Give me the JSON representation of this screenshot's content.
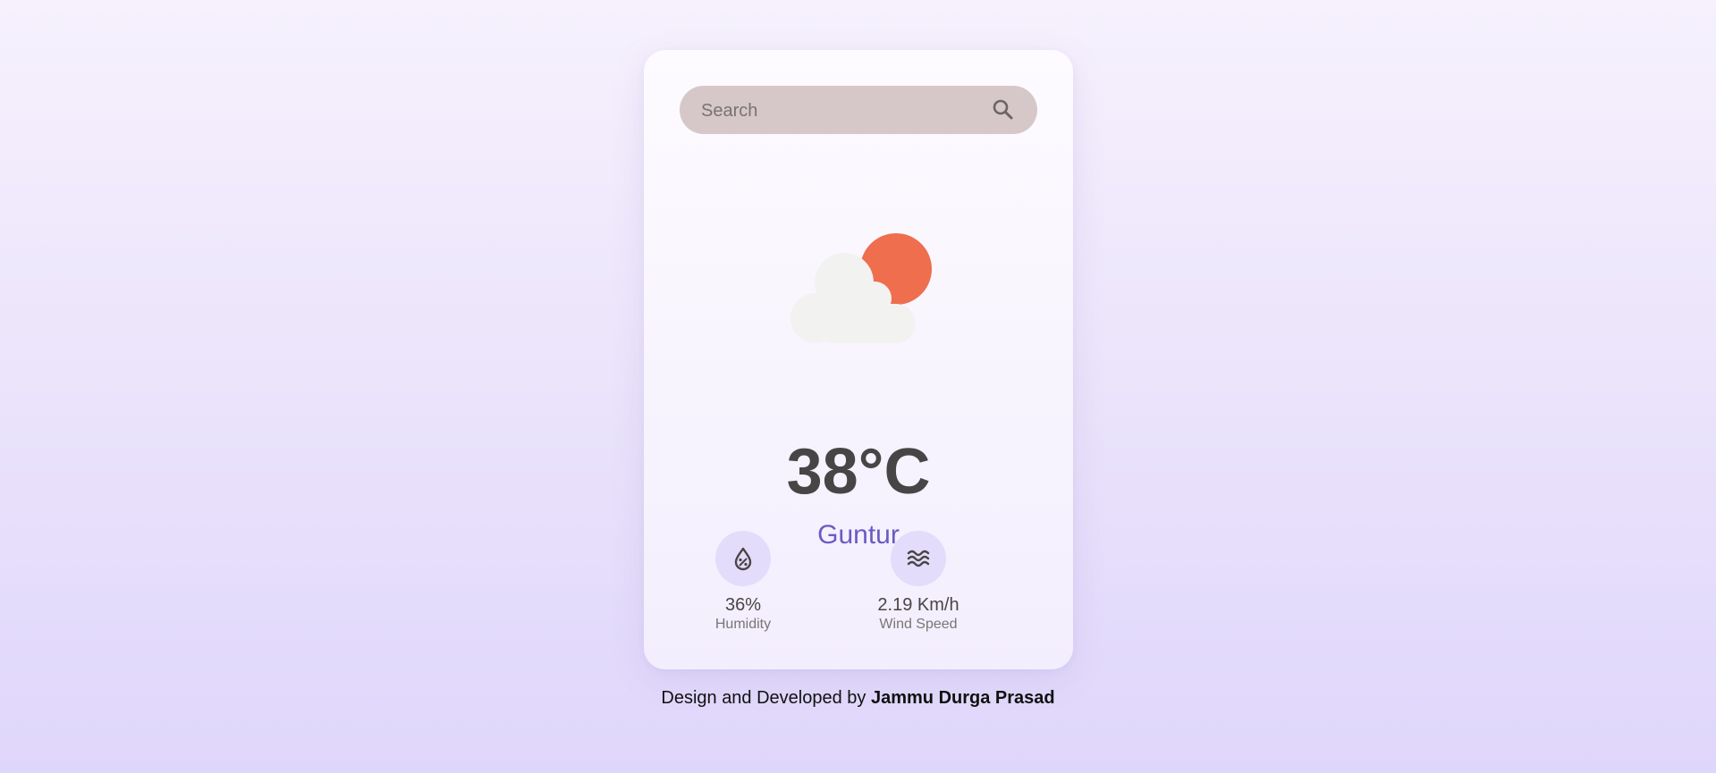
{
  "search": {
    "placeholder": "Search",
    "value": ""
  },
  "weather": {
    "icon": "partly-cloudy-icon",
    "temperature": "38°C",
    "city": "Guntur"
  },
  "stats": {
    "humidity": {
      "icon": "humidity-drop-icon",
      "value": "36%",
      "label": "Humidity"
    },
    "wind": {
      "icon": "wind-waves-icon",
      "value": "2.19 Km/h",
      "label": "Wind Speed"
    }
  },
  "footer": {
    "prefix": "Design and Developed by ",
    "author": "Jammu Durga Prasad"
  },
  "colors": {
    "accent": "#6a5bc4",
    "sun": "#ee6e4e",
    "cloud": "#f2f2f1",
    "search_bg": "#d6c8c8",
    "stat_circle": "#e3dcfb"
  }
}
